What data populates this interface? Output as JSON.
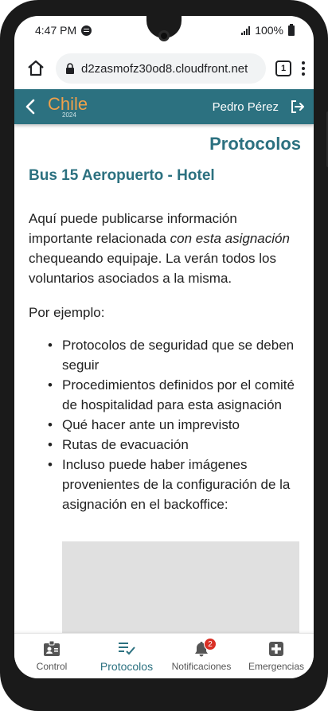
{
  "status_bar": {
    "time": "4:47 PM",
    "battery": "100%"
  },
  "browser": {
    "url": "d2zasmofz30od8.cloudfront.net",
    "tab_count": "1"
  },
  "header": {
    "brand": "Chile",
    "year": "2024",
    "user_name": "Pedro Pérez"
  },
  "main": {
    "page_title": "Protocolos",
    "assignment_title": "Bus 15 Aeropuerto - Hotel",
    "intro_part1": "Aquí puede publicarse información importante relacionada ",
    "intro_italic": "con esta asignación",
    "intro_part2": " chequeando equipaje. La verán todos los voluntarios asociados a la misma.",
    "example_label": "Por ejemplo:",
    "bullets": [
      "Protocolos de seguridad que se deben seguir",
      "Procedimientos definidos por el comité de hospitalidad para esta asignación",
      "Qué hacer ante un imprevisto",
      "Rutas de evacuación",
      "Incluso puede haber imágenes provenientes de la configuración de la asignación en el backoffice:"
    ]
  },
  "bottom_nav": {
    "items": [
      {
        "label": "Control",
        "icon": "id-badge-icon"
      },
      {
        "label": "Protocolos",
        "icon": "checklist-icon"
      },
      {
        "label": "Notificaciones",
        "icon": "bell-icon",
        "badge": "2"
      },
      {
        "label": "Emergencias",
        "icon": "medical-cross-icon"
      }
    ],
    "active": "Protocolos"
  },
  "colors": {
    "primary": "#2c7180",
    "brand_accent": "#f0a14a",
    "badge": "#d93025"
  }
}
